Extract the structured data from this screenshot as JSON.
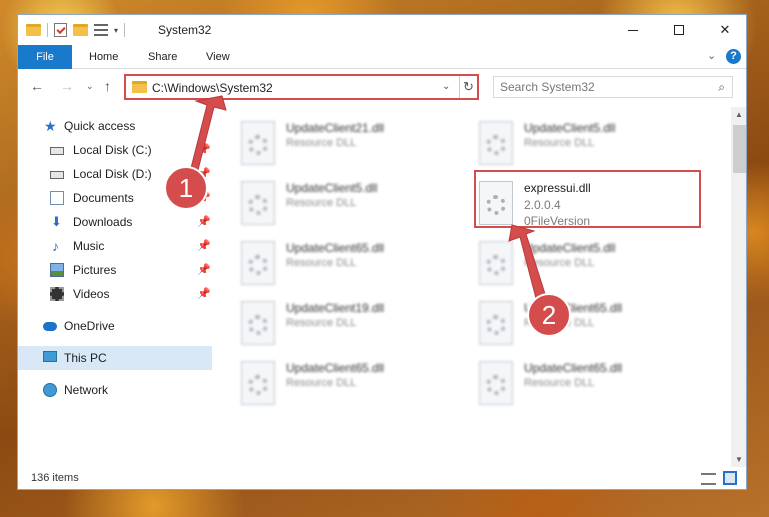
{
  "titlebar": {
    "title": "System32",
    "qat_dropdown": "▾",
    "minimize": "—",
    "maximize": "☐",
    "close": "✕"
  },
  "ribbon": {
    "tabs": [
      "File",
      "Home",
      "Share",
      "View"
    ],
    "collapse": "⌄",
    "help": "?"
  },
  "nav": {
    "back": "←",
    "forward": "→",
    "recent": "⌄",
    "up": "↑",
    "address": "C:\\Windows\\System32",
    "address_dropdown": "⌄",
    "refresh": "↻",
    "search_placeholder": "Search System32",
    "search_icon": "⌕"
  },
  "sidebar": [
    {
      "label": "Quick access",
      "icon": "star-icon",
      "pinned": false
    },
    {
      "label": "Local Disk (C:)",
      "icon": "drive-icon",
      "pinned": true
    },
    {
      "label": "Local Disk (D:)",
      "icon": "drive-icon",
      "pinned": true
    },
    {
      "label": "Documents",
      "icon": "documents-icon",
      "pinned": true
    },
    {
      "label": "Downloads",
      "icon": "download-icon",
      "pinned": true
    },
    {
      "label": "Music",
      "icon": "music-icon",
      "pinned": true
    },
    {
      "label": "Pictures",
      "icon": "pictures-icon",
      "pinned": true
    },
    {
      "label": "Videos",
      "icon": "videos-icon",
      "pinned": true
    },
    {
      "label": "OneDrive",
      "icon": "onedrive-icon",
      "pinned": false
    },
    {
      "label": "This PC",
      "icon": "pc-icon",
      "pinned": false,
      "selected": true
    },
    {
      "label": "Network",
      "icon": "network-icon",
      "pinned": false
    }
  ],
  "pin_glyph": "📌",
  "files": [
    {
      "name": "UpdateClient21.dll",
      "type": "Resource DLL"
    },
    {
      "name": "UpdateClient5.dll",
      "type": "Resource DLL"
    },
    {
      "name": "UpdateClient5.dll",
      "type": "Resource DLL"
    },
    {
      "name": "UpdateClient65.dll",
      "type": "Resource DLL"
    },
    {
      "name": "UpdateClient5.dll",
      "type": "Resource DLL"
    },
    {
      "name": "UpdateClient19.dll",
      "type": "Resource DLL"
    },
    {
      "name": "UpdateClient65.dll",
      "type": "Resource DLL"
    },
    {
      "name": "UpdateClient65.dll",
      "type": "Resource DLL"
    },
    {
      "name": "UpdateClient65.dll",
      "type": "Resource DLL"
    }
  ],
  "highlighted_file": {
    "name": "expressui.dll",
    "version": "2.0.0.4",
    "version_label": "0FileVersion"
  },
  "scrollbar": {
    "up": "▲",
    "down": "▼"
  },
  "status": {
    "items": "136 items"
  },
  "annotations": {
    "step1": "1",
    "step2": "2",
    "color": "#d54c4c"
  }
}
